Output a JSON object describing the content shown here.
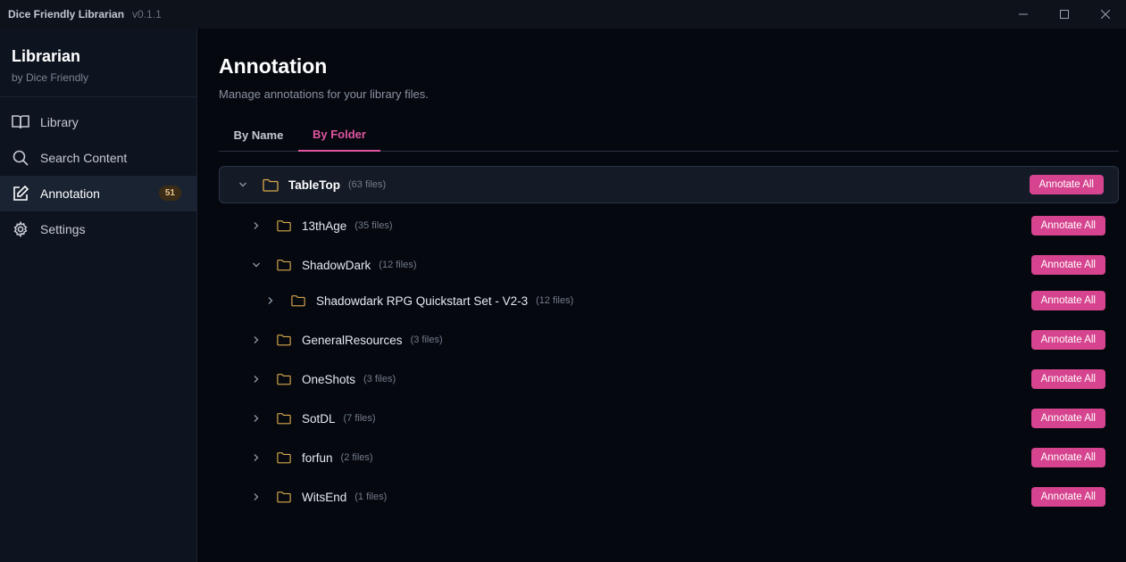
{
  "window": {
    "app_title": "Dice Friendly Librarian",
    "version": "v0.1.1"
  },
  "sidebar": {
    "brand_title": "Librarian",
    "brand_subtitle": "by Dice Friendly",
    "items": [
      {
        "label": "Library",
        "icon": "book-icon"
      },
      {
        "label": "Search Content",
        "icon": "search-icon"
      },
      {
        "label": "Annotation",
        "icon": "edit-icon",
        "badge": "51",
        "active": true
      },
      {
        "label": "Settings",
        "icon": "gear-icon"
      }
    ]
  },
  "main": {
    "title": "Annotation",
    "subtitle": "Manage annotations for your library files.",
    "tabs": [
      {
        "label": "By Name",
        "active": false
      },
      {
        "label": "By Folder",
        "active": true
      }
    ],
    "button_label": "Annotate All",
    "root": {
      "name": "TableTop",
      "count": "(63 files)",
      "expanded": true
    },
    "folders": [
      {
        "name": "13thAge",
        "count": "(35 files)",
        "expanded": false
      },
      {
        "name": "ShadowDark",
        "count": "(12 files)",
        "expanded": true
      },
      {
        "name": "Shadowdark RPG Quickstart Set - V2-3",
        "count": "(12 files)",
        "expanded": false,
        "nested": true
      },
      {
        "name": "GeneralResources",
        "count": "(3 files)",
        "expanded": false
      },
      {
        "name": "OneShots",
        "count": "(3 files)",
        "expanded": false
      },
      {
        "name": "SotDL",
        "count": "(7 files)",
        "expanded": false
      },
      {
        "name": "forfun",
        "count": "(2 files)",
        "expanded": false
      },
      {
        "name": "WitsEnd",
        "count": "(1 files)",
        "expanded": false
      }
    ]
  },
  "colors": {
    "accent": "#d6448f",
    "tab_active": "#e0559f",
    "folder": "#d9a94e",
    "background": "#05080f",
    "sidebar": "#0e141f"
  }
}
